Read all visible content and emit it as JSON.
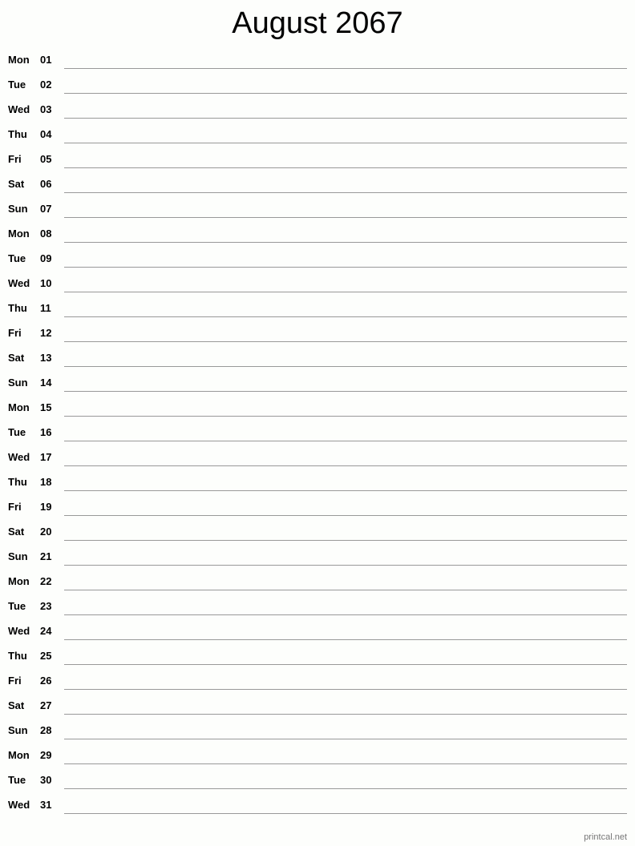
{
  "title": "August 2067",
  "days": [
    {
      "dow": "Mon",
      "day": "01"
    },
    {
      "dow": "Tue",
      "day": "02"
    },
    {
      "dow": "Wed",
      "day": "03"
    },
    {
      "dow": "Thu",
      "day": "04"
    },
    {
      "dow": "Fri",
      "day": "05"
    },
    {
      "dow": "Sat",
      "day": "06"
    },
    {
      "dow": "Sun",
      "day": "07"
    },
    {
      "dow": "Mon",
      "day": "08"
    },
    {
      "dow": "Tue",
      "day": "09"
    },
    {
      "dow": "Wed",
      "day": "10"
    },
    {
      "dow": "Thu",
      "day": "11"
    },
    {
      "dow": "Fri",
      "day": "12"
    },
    {
      "dow": "Sat",
      "day": "13"
    },
    {
      "dow": "Sun",
      "day": "14"
    },
    {
      "dow": "Mon",
      "day": "15"
    },
    {
      "dow": "Tue",
      "day": "16"
    },
    {
      "dow": "Wed",
      "day": "17"
    },
    {
      "dow": "Thu",
      "day": "18"
    },
    {
      "dow": "Fri",
      "day": "19"
    },
    {
      "dow": "Sat",
      "day": "20"
    },
    {
      "dow": "Sun",
      "day": "21"
    },
    {
      "dow": "Mon",
      "day": "22"
    },
    {
      "dow": "Tue",
      "day": "23"
    },
    {
      "dow": "Wed",
      "day": "24"
    },
    {
      "dow": "Thu",
      "day": "25"
    },
    {
      "dow": "Fri",
      "day": "26"
    },
    {
      "dow": "Sat",
      "day": "27"
    },
    {
      "dow": "Sun",
      "day": "28"
    },
    {
      "dow": "Mon",
      "day": "29"
    },
    {
      "dow": "Tue",
      "day": "30"
    },
    {
      "dow": "Wed",
      "day": "31"
    }
  ],
  "footer": "printcal.net"
}
